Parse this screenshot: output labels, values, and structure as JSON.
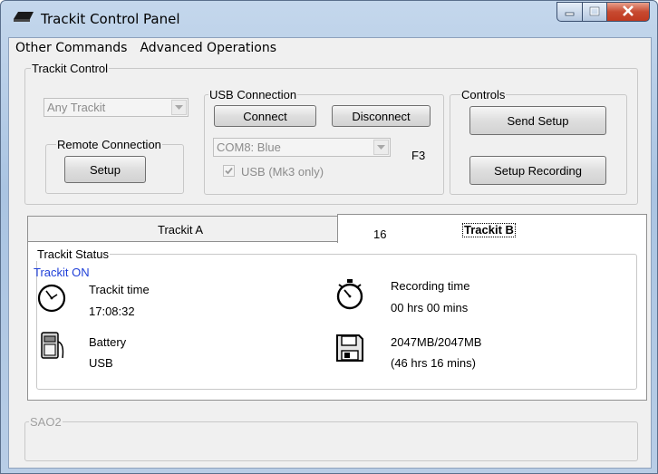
{
  "window": {
    "title": "Trackit Control Panel"
  },
  "menu": [
    "Other Commands",
    "Advanced Operations"
  ],
  "trackit_control": {
    "label": "Trackit Control",
    "device_combo": "Any Trackit",
    "remote": {
      "label": "Remote Connection",
      "setup_button": "Setup"
    }
  },
  "usb": {
    "label": "USB Connection",
    "connect_button": "Connect",
    "disconnect_button": "Disconnect",
    "port_combo": "COM8: Blue",
    "hotkey": "F3",
    "usb_checkbox_label": "USB (Mk3 only)"
  },
  "controls": {
    "label": "Controls",
    "send_setup_button": "Send Setup",
    "setup_recording_button": "Setup Recording"
  },
  "tabs": {
    "tab_a": "Trackit A",
    "tab_b": "Trackit B",
    "tab_b_number": "16"
  },
  "status": {
    "label": "Trackit Status",
    "state": "Trackit ON",
    "state_color": "#1f3fd8",
    "trackit_time_label": "Trackit time",
    "trackit_time_value": "17:08:32",
    "battery_label": "Battery",
    "battery_value": "USB",
    "recording_time_label": "Recording time",
    "recording_time_value": "00 hrs 00 mins",
    "storage_value": "2047MB/2047MB",
    "storage_time": "(46 hrs 16 mins)"
  },
  "sao2": {
    "label": "SAO2"
  },
  "icons": [
    "trackit-app-icon",
    "minimize-icon",
    "maximize-icon",
    "close-icon",
    "clock-icon",
    "battery-icon",
    "stopwatch-icon",
    "floppy-disk-icon"
  ]
}
